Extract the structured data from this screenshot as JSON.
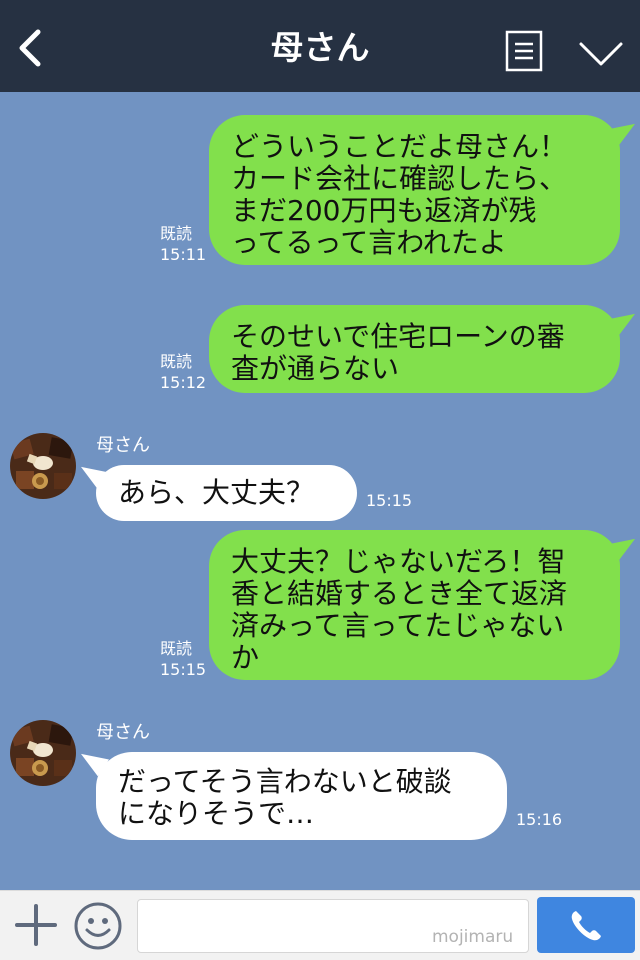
{
  "header": {
    "title": "母さん",
    "icons": [
      "back-icon",
      "menu-icon",
      "chevron-down-icon"
    ]
  },
  "messages": [
    {
      "direction": "out",
      "text": "どういうことだよ母さん！\nカード会社に確認したら、\nまだ200万円も返済が残\nってるって言われたよ",
      "read": "既読",
      "time": "15:11"
    },
    {
      "direction": "out",
      "text": "そのせいで住宅ローンの審\n査が通らない",
      "read": "既読",
      "time": "15:12"
    },
    {
      "direction": "in",
      "sender": "母さん",
      "text": "あら、大丈夫？",
      "time": "15:15"
    },
    {
      "direction": "out",
      "text": "大丈夫？じゃないだろ！智\n香と結婚するとき全て返済\n済みって言ってたじゃない\nか",
      "read": "既読",
      "time": "15:15"
    },
    {
      "direction": "in",
      "sender": "母さん",
      "text": "だってそう言わないと破談\nになりそうで…",
      "time": "15:16"
    }
  ],
  "input_bar": {
    "placeholder": "",
    "watermark": "mojimaru",
    "icons": [
      "plus-icon",
      "smiley-icon",
      "phone-icon"
    ]
  },
  "colors": {
    "background": "#7193c2",
    "header": "#263142",
    "bubble_out": "#82e04c",
    "bubble_in": "#ffffff",
    "send_button": "#3f86e0"
  }
}
